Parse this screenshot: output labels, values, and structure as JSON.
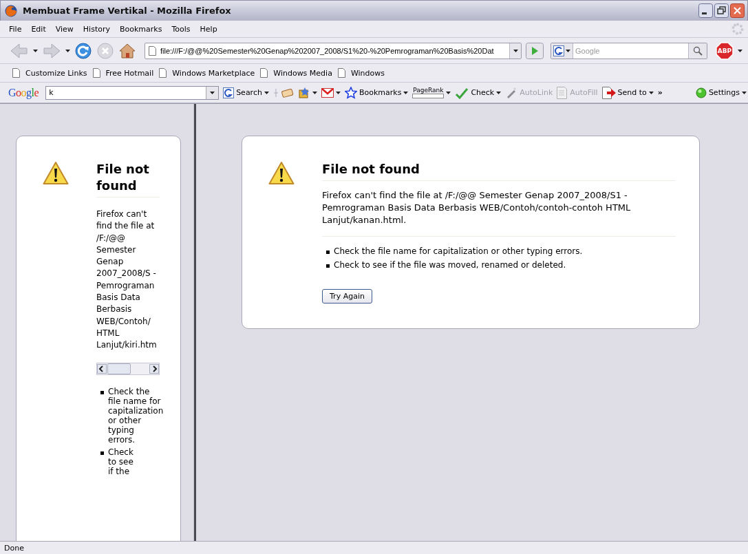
{
  "window": {
    "title": "Membuat Frame Vertikal - Mozilla Firefox"
  },
  "menu_bar": {
    "items": [
      "File",
      "Edit",
      "View",
      "History",
      "Bookmarks",
      "Tools",
      "Help"
    ]
  },
  "navigation": {
    "url": "file:///F:/@@%20Semester%20Genap%202007_2008/S1%20-%20Pemrograman%20Basis%20Dat",
    "search_placeholder": "Google",
    "adblock_label": "ABP"
  },
  "bookmarks": [
    "Customize Links",
    "Free Hotmail",
    "Windows Marketplace",
    "Windows Media",
    "Windows"
  ],
  "google_toolbar": {
    "logo": "Google",
    "query": "k",
    "overflow": "»",
    "items": [
      {
        "kind": "search",
        "label": "Search",
        "menu": true,
        "disabled": false
      },
      {
        "kind": "highlight",
        "menu": false,
        "disabled": false
      },
      {
        "kind": "options",
        "menu": true,
        "disabled": false
      },
      {
        "kind": "gmail",
        "menu": true,
        "disabled": false
      },
      {
        "kind": "bookmarks",
        "label": "Bookmarks",
        "menu": true,
        "disabled": false
      },
      {
        "kind": "pagerank",
        "label": "PageRank",
        "menu": true,
        "disabled": false,
        "level": 0
      },
      {
        "kind": "check",
        "label": "Check",
        "menu": true,
        "disabled": false
      },
      {
        "kind": "autolink",
        "label": "AutoLink",
        "menu": false,
        "disabled": true
      },
      {
        "kind": "autofill",
        "label": "AutoFill",
        "menu": false,
        "disabled": true
      },
      {
        "kind": "sendto",
        "label": "Send to",
        "menu": true,
        "disabled": false
      }
    ],
    "settings": {
      "label": "Settings",
      "menu": true
    }
  },
  "frames": [
    {
      "kind": "narrow",
      "title": "File not found",
      "message": "Firefox can't find the file at /F:/@@ Semester Genap 2007_2008/S - Pemrograman Basis Data Berbasis WEB/Contoh/ HTML Lanjut/kiri.htm",
      "tips": [
        "Check the file name for capitalization or other typing errors.",
        "Check to see if the"
      ]
    },
    {
      "kind": "wide",
      "title": "File not found",
      "message": "Firefox can't find the file at /F:/@@ Semester Genap 2007_2008/S1 - Pemrograman Basis Data Berbasis WEB/Contoh/contoh-contoh HTML Lanjut/kanan.html.",
      "tips": [
        "Check the file name for capitalization or other typing errors.",
        "Check to see if the file was moved, renamed or deleted."
      ],
      "button": "Try Again"
    }
  ],
  "status_bar": {
    "text": "Done"
  }
}
